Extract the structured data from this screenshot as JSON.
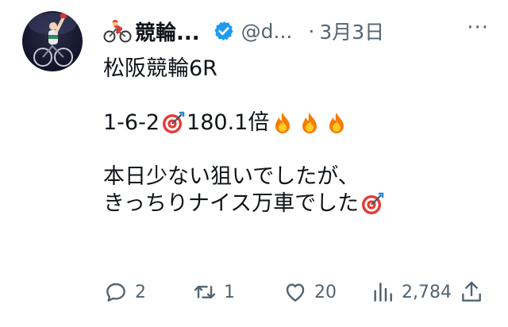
{
  "tweet": {
    "author": {
      "display_name": "競輪...",
      "handle": "@d...",
      "verified": true,
      "name_emoji": "bicycle-rider-icon"
    },
    "separator": "·",
    "date": "3月3日",
    "more_label": "···",
    "lines": [
      "松阪競輪6R",
      "1-6-2",
      "180.1倍",
      "本日少ない狙いでしたが、",
      "きっちりナイス万車でした"
    ],
    "actions": {
      "replies": "2",
      "retweets": "1",
      "likes": "20",
      "views": "2,784"
    },
    "colors": {
      "text": "#0f1419",
      "muted": "#536471",
      "verified_badge": "#1d9bf0"
    }
  }
}
